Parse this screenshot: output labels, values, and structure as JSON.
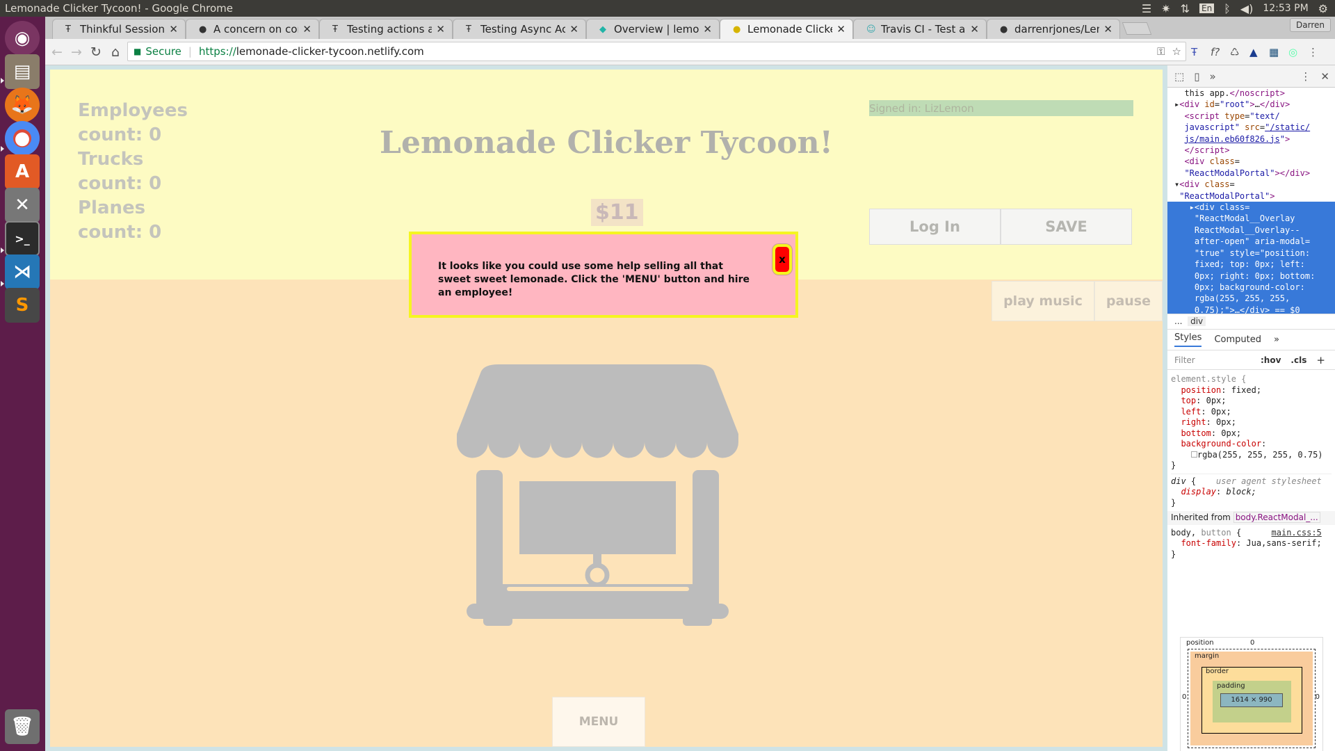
{
  "os": {
    "window_title": "Lemonade Clicker Tycoon! - Google Chrome",
    "lang": "En",
    "clock": "12:53 PM"
  },
  "browser": {
    "tabs": [
      {
        "label": "Thinkful Sessions",
        "icon": "thinkful-icon"
      },
      {
        "label": "A concern on comb",
        "icon": "github-icon"
      },
      {
        "label": "Testing actions and",
        "icon": "thinkful-icon"
      },
      {
        "label": "Testing Async Actio",
        "icon": "thinkful-icon"
      },
      {
        "label": "Overview | lemonac",
        "icon": "netlify-icon"
      },
      {
        "label": "Lemonade Clicker T",
        "icon": "lemon-icon",
        "active": true
      },
      {
        "label": "Travis CI - Test and D",
        "icon": "travis-icon"
      },
      {
        "label": "darrenrjones/Lemo",
        "icon": "github-icon"
      }
    ],
    "profile": "Darren",
    "secure_label": "Secure",
    "url_scheme": "https://",
    "url_host": "lemonade-clicker-tycoon.netlify.com"
  },
  "game": {
    "stats": [
      {
        "name": "Employees",
        "count_label": "count: 0"
      },
      {
        "name": "Trucks",
        "count_label": "count: 0"
      },
      {
        "name": "Planes",
        "count_label": "count: 0"
      }
    ],
    "title": "Lemonade Clicker Tycoon!",
    "signed_in": "Signed in: LizLemon",
    "money": "$11",
    "login_label": "Log In",
    "save_label": "SAVE",
    "play_music_label": "play music",
    "pause_label": "pause",
    "menu_label": "MENU",
    "modal": {
      "message": "It looks like you could use some help selling all that sweet sweet lemonade. Click the 'MENU' button and hire an employee!",
      "close_label": "x"
    }
  },
  "devtools": {
    "breadcrumb_ellipsis": "...",
    "breadcrumb": "div",
    "tab_styles": "Styles",
    "tab_computed": "Computed",
    "filter_placeholder": "Filter",
    "hov": ":hov",
    "cls": ".cls",
    "inherited_label": "Inherited from",
    "inherited_from": "body.ReactModal_...",
    "css_source": "main.css:5",
    "box": {
      "position_label": "position",
      "margin_label": "margin",
      "border_label": "border",
      "padding_label": "padding",
      "size": "1614 × 990",
      "zero": "0",
      "dash": "–"
    }
  }
}
